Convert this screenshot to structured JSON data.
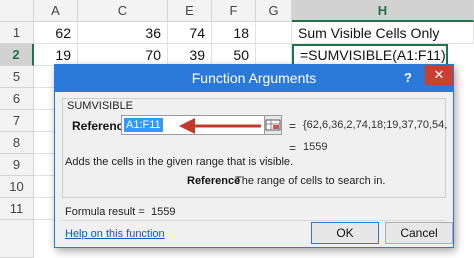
{
  "sheet": {
    "columns": [
      "A",
      "C",
      "E",
      "F",
      "G",
      "H"
    ],
    "rows": [
      {
        "num": "1",
        "a": "62",
        "c": "36",
        "e": "74",
        "f": "18",
        "h": "Sum Visible Cells Only"
      },
      {
        "num": "2",
        "a": "19",
        "c": "70",
        "e": "39",
        "f": "50",
        "h": "=SUMVISIBLE(A1:F11)"
      },
      {
        "num": "5",
        "a": "",
        "c": "",
        "e": "",
        "f": "",
        "h": ""
      },
      {
        "num": "6"
      },
      {
        "num": "7"
      },
      {
        "num": "8"
      },
      {
        "num": "9"
      },
      {
        "num": "10"
      },
      {
        "num": "11"
      }
    ]
  },
  "dialog": {
    "title": "Function Arguments",
    "help_glyph": "?",
    "close_glyph": "✕",
    "function_name": "SUMVISIBLE",
    "arg_label": "Reference",
    "arg_input": "A1:F11",
    "arg_eq": "=",
    "arg_value": "{62,6,36,2,74,18;19,37,70,54,39,50;...",
    "result_eq": "=",
    "result_value": "1559",
    "description": "Adds the cells in the given range that is visible.",
    "arg_help_name": "Reference",
    "arg_help_text": "The range of cells to search in.",
    "formula_result_label": "Formula result =",
    "formula_result_value": "1559",
    "help_link": "Help on this function",
    "ok_label": "OK",
    "cancel_label": "Cancel"
  },
  "colors": {
    "accent": "#2b79d9",
    "excel_green": "#217346",
    "arrow": "#c0392b",
    "close": "#c84031"
  }
}
